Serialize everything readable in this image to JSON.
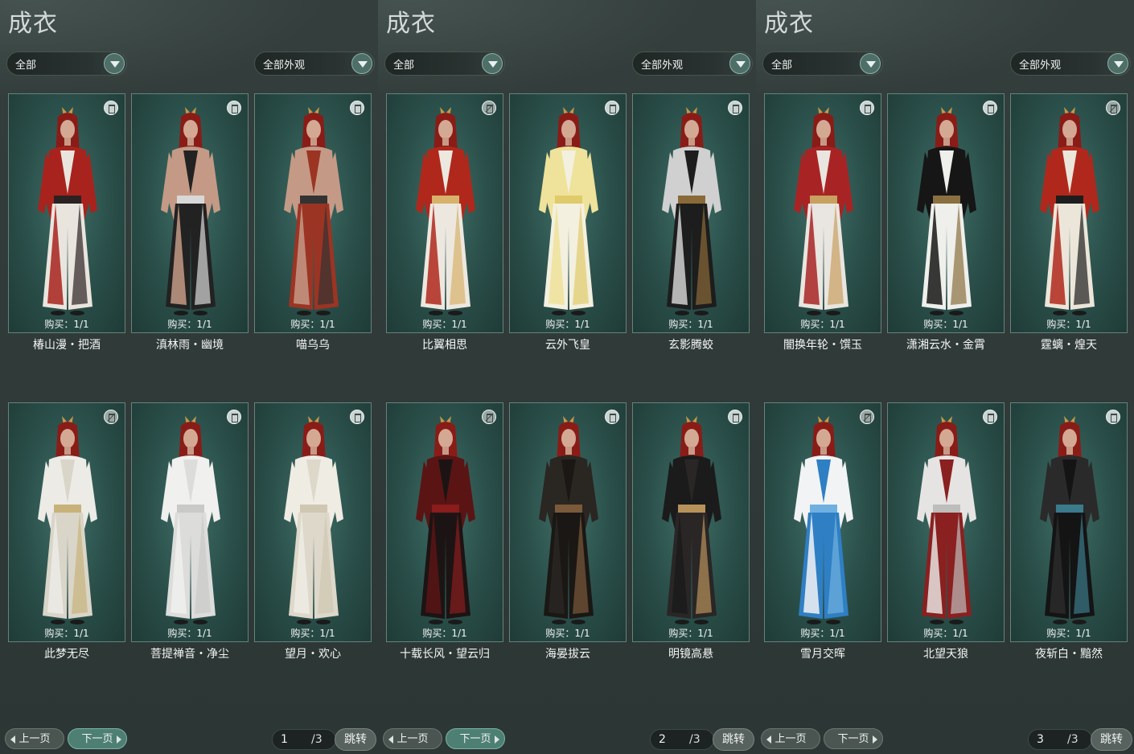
{
  "panels": [
    {
      "title": "成衣",
      "filter_left": "全部",
      "filter_right": "全部外观",
      "items": [
        {
          "purchase": "购买：1/1",
          "name": "椿山漫・把酒",
          "trash": "on",
          "colors": [
            "#a8231d",
            "#e9e5de",
            "#2a2222"
          ]
        },
        {
          "purchase": "购买：1/1",
          "name": "滇林雨・幽境",
          "trash": "on",
          "colors": [
            "#c49a86",
            "#222222",
            "#d8d8d8"
          ]
        },
        {
          "purchase": "购买：1/1",
          "name": "喵乌乌",
          "trash": "on",
          "colors": [
            "#c49a86",
            "#9c3424",
            "#333333"
          ]
        },
        {
          "purchase": "购买：1/1",
          "name": "此梦无尽",
          "trash": "off",
          "colors": [
            "#ecebe6",
            "#d9d5c8",
            "#c8b27a"
          ]
        },
        {
          "purchase": "购买：1/1",
          "name": "菩提禅音・净尘",
          "trash": "on",
          "colors": [
            "#f0f0ee",
            "#dcdcda",
            "#c9c9c7"
          ]
        },
        {
          "purchase": "购买：1/1",
          "name": "望月・欢心",
          "trash": "on",
          "colors": [
            "#efece4",
            "#ddd8ca",
            "#cfc7b2"
          ]
        }
      ],
      "prev_label": "上一页",
      "next_label": "下一页",
      "page": "1",
      "total": "/3",
      "jump_label": "跳转"
    },
    {
      "title": "成衣",
      "filter_left": "全部",
      "filter_right": "全部外观",
      "items": [
        {
          "purchase": "购买：1/1",
          "name": "比翼相思",
          "trash": "off",
          "colors": [
            "#b0281c",
            "#ece8e0",
            "#d8b26a"
          ]
        },
        {
          "purchase": "购买：1/1",
          "name": "云外飞皇",
          "trash": "on",
          "colors": [
            "#efe29a",
            "#f3f0e0",
            "#dfcb6a"
          ]
        },
        {
          "purchase": "购买：1/1",
          "name": "玄影腾蛟",
          "trash": "on",
          "colors": [
            "#cfd0cf",
            "#1d1d1d",
            "#8a6a38"
          ]
        },
        {
          "purchase": "购买：1/1",
          "name": "十载长风・望云归",
          "trash": "off",
          "colors": [
            "#5a1414",
            "#1c1414",
            "#8a1c1c"
          ]
        },
        {
          "purchase": "购买：1/1",
          "name": "海晏拔云",
          "trash": "on",
          "colors": [
            "#2a2622",
            "#1a1714",
            "#7a5a3a"
          ]
        },
        {
          "purchase": "购买：1/1",
          "name": "明镜高悬",
          "trash": "on",
          "colors": [
            "#1b1b1b",
            "#2a2626",
            "#b8925a"
          ]
        }
      ],
      "prev_label": "上一页",
      "next_label": "下一页",
      "page": "2",
      "total": "/3",
      "jump_label": "跳转"
    },
    {
      "title": "成衣",
      "filter_left": "全部",
      "filter_right": "全部外观",
      "items": [
        {
          "purchase": "购买：1/1",
          "name": "闇换年轮・馔玉",
          "trash": "on",
          "colors": [
            "#a82424",
            "#e9e5e0",
            "#c8a060"
          ]
        },
        {
          "purchase": "购买：1/1",
          "name": "潇湘云水・金霄",
          "trash": "on",
          "colors": [
            "#161616",
            "#efefec",
            "#8a7040"
          ]
        },
        {
          "purchase": "购买：1/1",
          "name": "霆螭・煌天",
          "trash": "off",
          "colors": [
            "#b0281c",
            "#ece6da",
            "#1d1d1d"
          ]
        },
        {
          "purchase": "购买：1/1",
          "name": "雪月交晖",
          "trash": "off",
          "colors": [
            "#f2f3f4",
            "#2f7fc4",
            "#6fb0e0"
          ]
        },
        {
          "purchase": "购买：1/1",
          "name": "北望天狼",
          "trash": "on",
          "colors": [
            "#e6e4e2",
            "#8a2020",
            "#bdbdbb"
          ]
        },
        {
          "purchase": "购买：1/1",
          "name": "夜斩白・黯然",
          "trash": "on",
          "colors": [
            "#2a2a2a",
            "#141414",
            "#3a7a8a"
          ]
        }
      ],
      "prev_label": "上一页",
      "next_label": "下一页",
      "page": "3",
      "total": "/3",
      "jump_label": "跳转"
    }
  ]
}
